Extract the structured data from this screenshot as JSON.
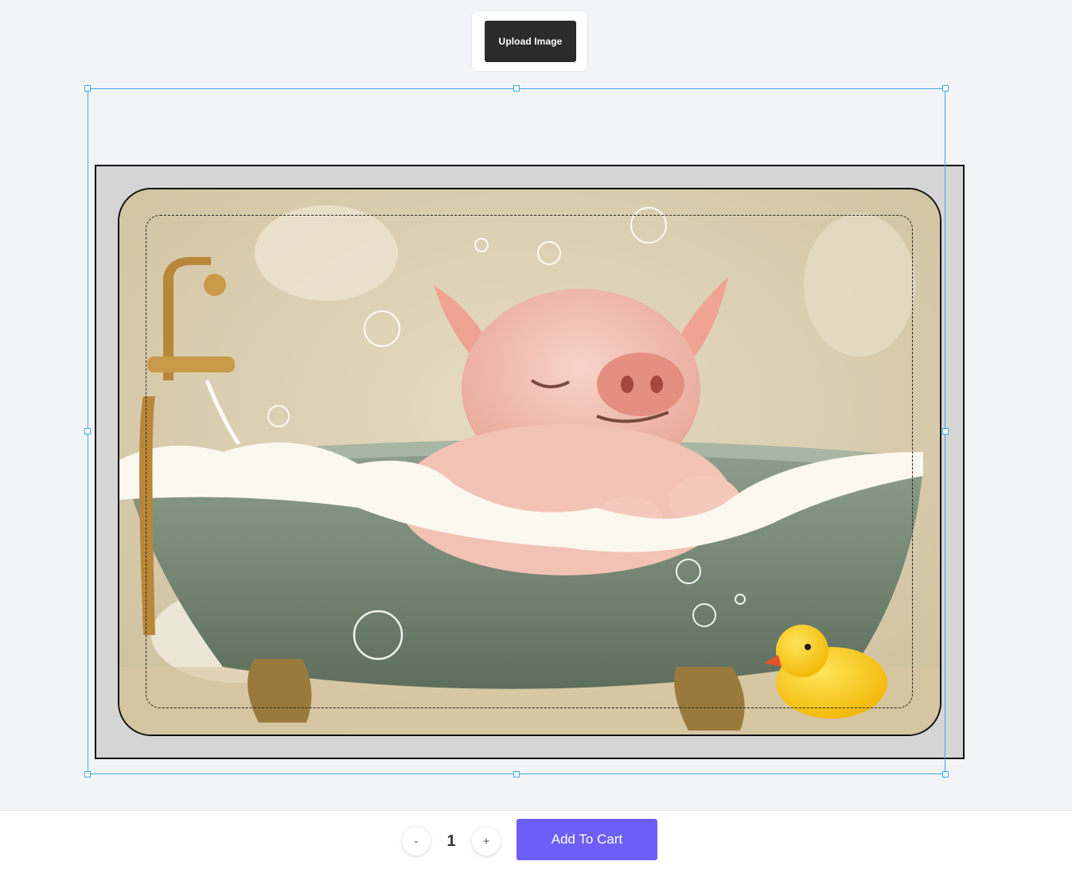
{
  "toolbar": {
    "upload_label": "Upload Image"
  },
  "canvas": {
    "artwork": {
      "description_icon": "pig-in-bathtub-image"
    }
  },
  "cart": {
    "decrease_label": "-",
    "quantity": "1",
    "increase_label": "+",
    "add_to_cart_label": "Add To Cart"
  },
  "colors": {
    "accent": "#6c5ef7",
    "upload_button": "#2b2b2b",
    "selection": "#3aa8e6"
  }
}
